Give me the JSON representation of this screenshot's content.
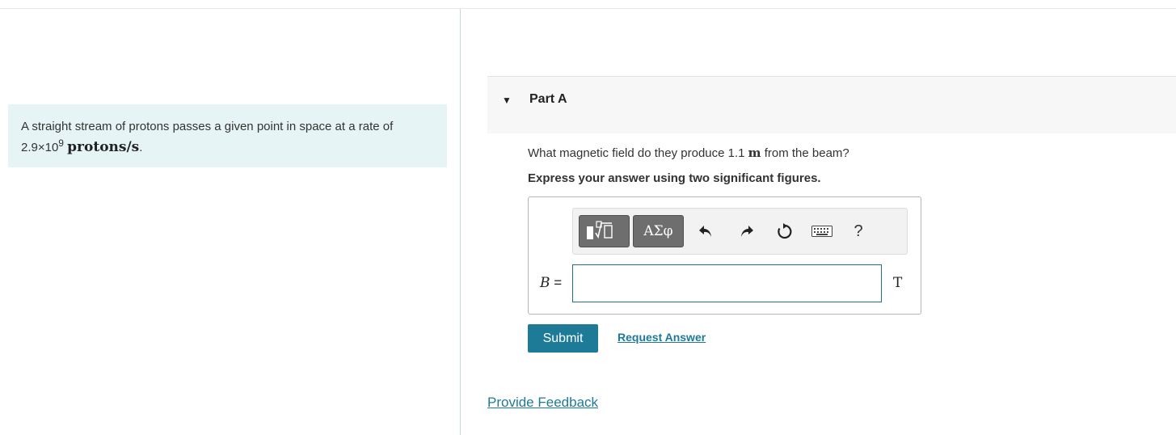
{
  "intro": {
    "text": "A straight stream of protons passes a given point in space at a rate of",
    "rate_mantissa": "2.9×10",
    "rate_exponent": "9",
    "rate_units": "protons/s",
    "rate_period": "."
  },
  "part": {
    "title": "Part A",
    "question_before": "What magnetic field do they produce 1.1 ",
    "question_unit": "m",
    "question_after": " from the beam?",
    "instruction": "Express your answer using two significant figures."
  },
  "toolbar": {
    "templates_icon": "templates-sqrt-icon",
    "greek_label": "ΑΣφ",
    "undo_icon": "undo-icon",
    "redo_icon": "redo-icon",
    "reset_icon": "reset-icon",
    "keyboard_icon": "keyboard-icon",
    "help_label": "?"
  },
  "answer": {
    "variable": "B",
    "equals": " =",
    "value": "",
    "unit": "T"
  },
  "actions": {
    "submit_label": "Submit",
    "request_label": "Request Answer",
    "feedback_label": "Provide Feedback"
  },
  "colors": {
    "accent": "#1d7b98",
    "intro_background": "#e6f4f5",
    "part_header_background": "#f7f7f7"
  }
}
